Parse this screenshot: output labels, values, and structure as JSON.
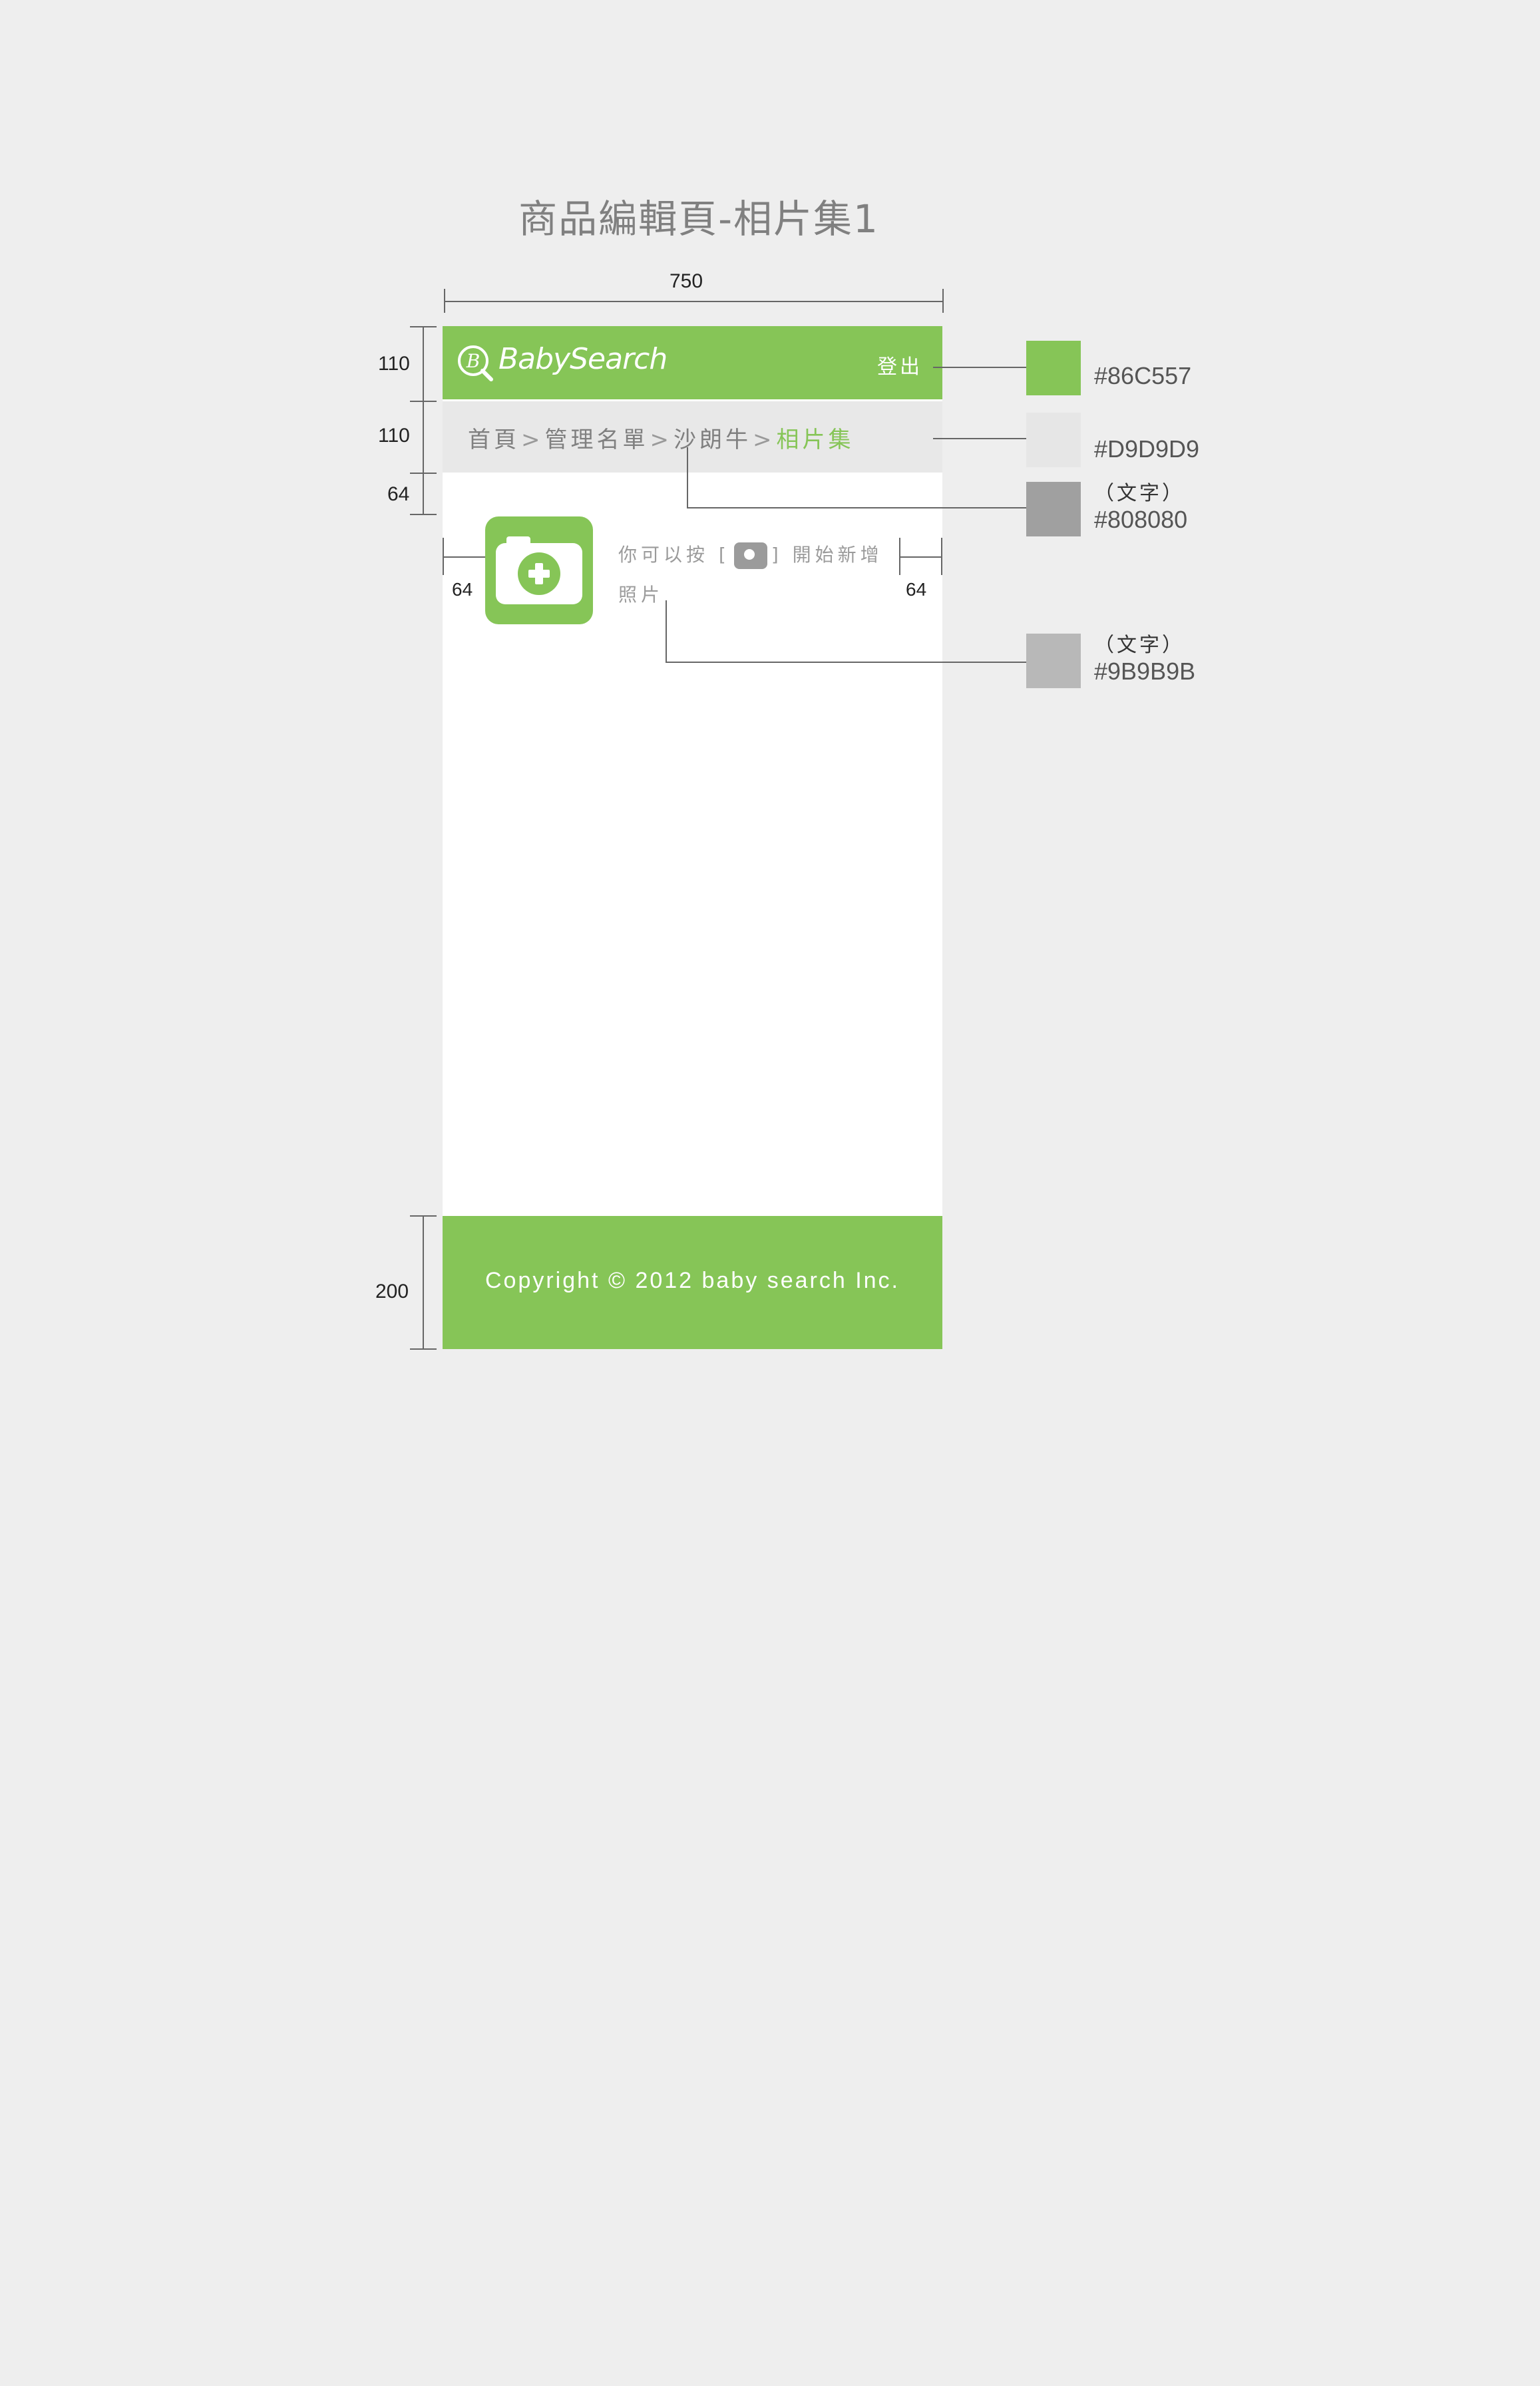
{
  "spec": {
    "title": "商品編輯頁-相片集1",
    "dims": {
      "width": "750",
      "navbar_height": "110",
      "breadcrumb_height": "110",
      "content_top": "64",
      "left_margin": "64",
      "right_margin": "64",
      "footer_height": "200"
    }
  },
  "navbar": {
    "logo_text": "BabySearch",
    "logout_label": "登出"
  },
  "breadcrumb": {
    "items": [
      "首頁",
      "管理名單",
      "沙朗牛"
    ],
    "current": "相片集",
    "separator": ">"
  },
  "content": {
    "hint_prefix": "你可以按 [",
    "hint_suffix": "] 開始新增照片"
  },
  "footer": {
    "copyright": "Copyright © 2012 baby search Inc."
  },
  "swatches": [
    {
      "color": "#86C557",
      "note": "",
      "label": "#86C557"
    },
    {
      "color": "#E6E6E6",
      "note": "",
      "label": "#D9D9D9"
    },
    {
      "color": "#A0A0A0",
      "note": "（文字）",
      "label": "#808080"
    },
    {
      "color": "#B8B8B8",
      "note": "（文字）",
      "label": "#9B9B9B"
    }
  ]
}
